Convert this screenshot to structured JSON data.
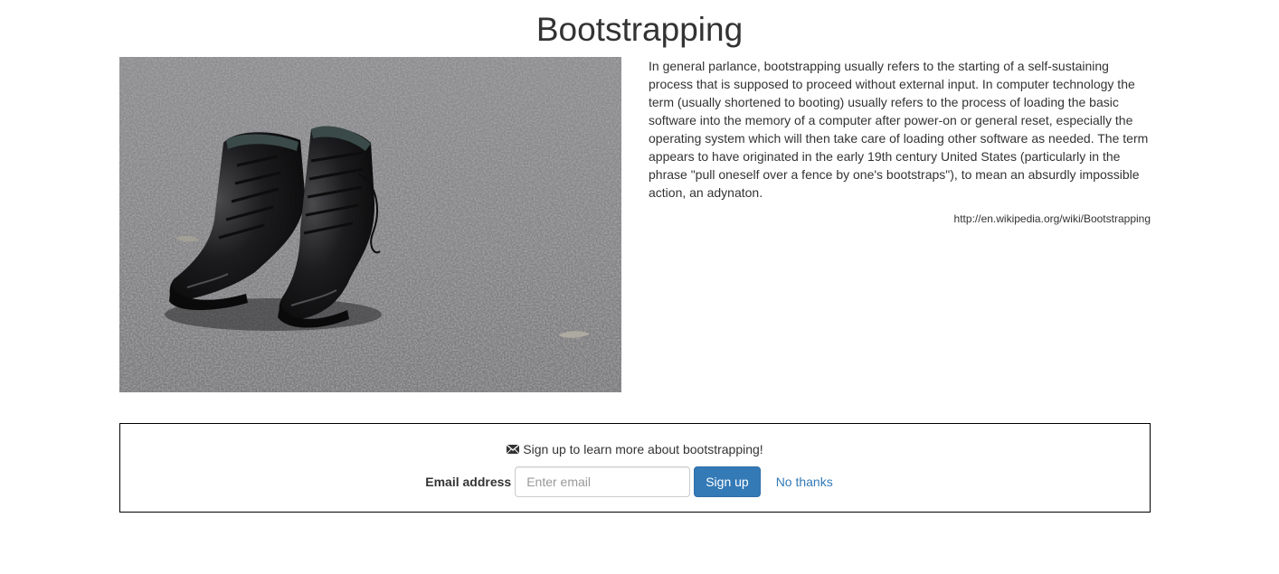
{
  "page": {
    "title": "Bootstrapping"
  },
  "image": {
    "description": "boots-photo",
    "alt": "A pair of worn black lace-up boots standing on gravel asphalt"
  },
  "article": {
    "text": "In general parlance, bootstrapping usually refers to the starting of a self-sustaining process that is supposed to proceed without external input. In computer technology the term (usually shortened to booting) usually refers to the process of loading the basic software into the memory of a computer after power-on or general reset, especially the operating system which will then take care of loading other software as needed. The term appears to have originated in the early 19th century United States (particularly in the phrase \"pull oneself over a fence by one's bootstraps\"), to mean an absurdly impossible action, an adynaton.",
    "source": "http://en.wikipedia.org/wiki/Bootstrapping"
  },
  "signup": {
    "message": "Sign up to learn more about bootstrapping!",
    "message_icon": "envelope-icon",
    "email_label": "Email address",
    "email_placeholder": "Enter email",
    "email_value": "",
    "signup_label": "Sign up",
    "no_thanks_label": "No thanks"
  },
  "colors": {
    "primary": "#337ab7",
    "text": "#333333",
    "border": "#000000"
  }
}
